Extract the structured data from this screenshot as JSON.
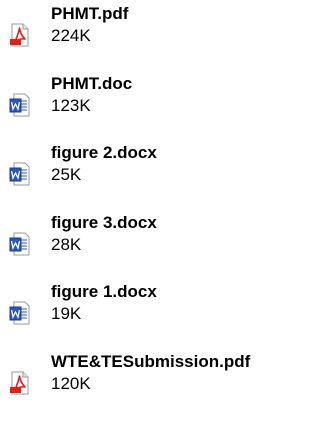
{
  "files": [
    {
      "name": "PHMT.pdf",
      "size": "224K",
      "icon": "pdf-icon"
    },
    {
      "name": "PHMT.doc",
      "size": "123K",
      "icon": "word-doc-icon"
    },
    {
      "name": "figure 2.docx",
      "size": "25K",
      "icon": "word-doc-icon"
    },
    {
      "name": "figure 3.docx",
      "size": "28K",
      "icon": "word-doc-icon"
    },
    {
      "name": "figure 1.docx",
      "size": "19K",
      "icon": "word-doc-icon"
    },
    {
      "name": "WTE&TESubmission.pdf",
      "size": "120K",
      "icon": "pdf-icon"
    }
  ],
  "colors": {
    "pdf_red": "#d9241b",
    "word_blue": "#2b56b5",
    "word_dark": "#1a3c8c"
  }
}
